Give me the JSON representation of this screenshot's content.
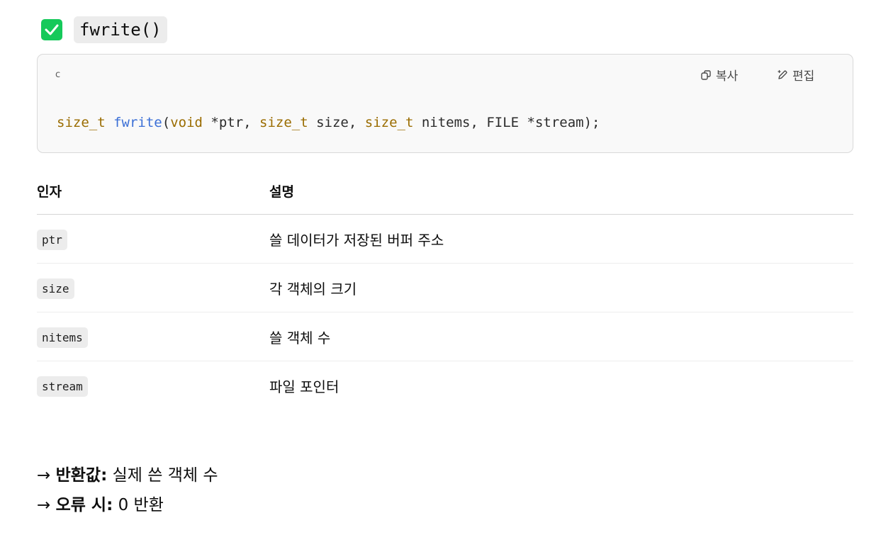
{
  "heading": {
    "checkbox_icon": "check-icon",
    "checkbox_color": "#15c95a",
    "title": "fwrite()"
  },
  "code_block": {
    "language": "c",
    "copy_label": "복사",
    "edit_label": "편집",
    "tokens": {
      "return_type": "size_t",
      "fn_name": "fwrite",
      "paren_open": "(",
      "p1_type": "void",
      "p1_rest": " *ptr, ",
      "p2_type": "size_t",
      "p2_rest": " size, ",
      "p3_type": "size_t",
      "p3_rest": " nitems, FILE *stream);"
    },
    "colors": {
      "type": "#9a6c00",
      "function": "#3b6fd6"
    }
  },
  "table": {
    "headers": [
      "인자",
      "설명"
    ],
    "rows": [
      {
        "arg": "ptr",
        "desc": "쓸 데이터가 저장된 버퍼 주소"
      },
      {
        "arg": "size",
        "desc": "각 객체의 크기"
      },
      {
        "arg": "nitems",
        "desc": "쓸 객체 수"
      },
      {
        "arg": "stream",
        "desc": "파일 포인터"
      }
    ]
  },
  "notes": [
    {
      "arrow": "→",
      "label": "반환값:",
      "text": "실제 쓴 객체 수"
    },
    {
      "arrow": "→",
      "label": "오류 시:",
      "text": "0 반환"
    }
  ]
}
